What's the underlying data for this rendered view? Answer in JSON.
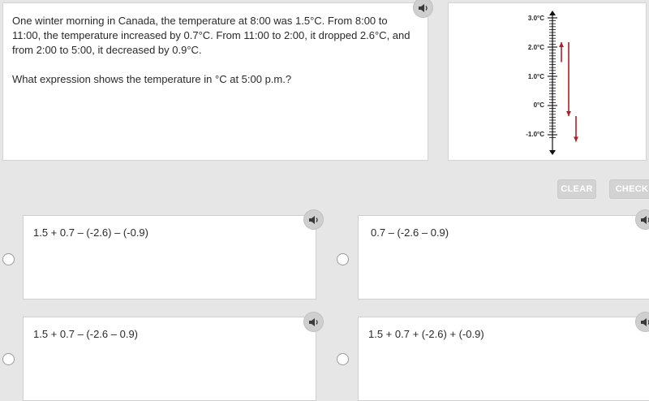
{
  "question": {
    "paragraph1": "One winter morning in Canada, the temperature at 8:00 was 1.5°C. From 8:00 to 11:00, the temperature increased by 0.7°C. From 11:00 to 2:00, it dropped 2.6°C, and from 2:00 to 5:00, it decreased by 0.9°C.",
    "paragraph2": "What expression shows the temperature in °C at 5:00 p.m.?"
  },
  "thermometer": {
    "labels": [
      "3.0°C",
      "2.0°C",
      "1.0°C",
      "0°C",
      "-1.0°C"
    ],
    "arrow_color": "#b02020"
  },
  "buttons": {
    "clear": "CLEAR",
    "check": "CHECK"
  },
  "answers": [
    {
      "text": "1.5 + 0.7 – (-2.6) – (-0.9)"
    },
    {
      "text": "0.7 – (-2.6 – 0.9)"
    },
    {
      "text": "1.5 + 0.7 – (-2.6 – 0.9)"
    },
    {
      "text": "1.5 + 0.7 + (-2.6) + (-0.9)"
    }
  ]
}
